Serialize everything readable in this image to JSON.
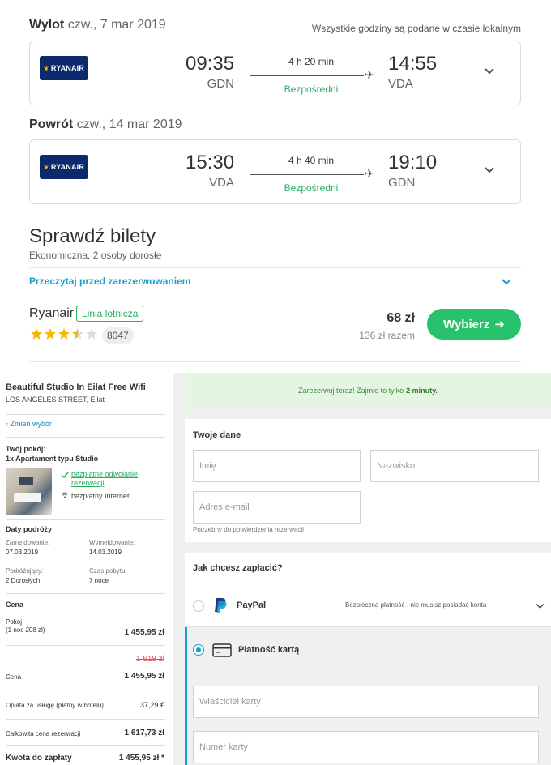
{
  "outbound": {
    "label": "Wylot",
    "date": "czw., 7 mar 2019",
    "airline_logo": "RYANAIR",
    "dep_time": "09:35",
    "dep_airport": "GDN",
    "duration": "4 h 20 min",
    "direct": "Bezpośredni",
    "arr_time": "14:55",
    "arr_airport": "VDA"
  },
  "timezone_note": "Wszystkie godziny są podane w czasie lokalnym",
  "inbound": {
    "label": "Powrót",
    "date": "czw., 14 mar 2019",
    "airline_logo": "RYANAIR",
    "dep_time": "15:30",
    "dep_airport": "VDA",
    "duration": "4 h 40 min",
    "direct": "Bezpośredni",
    "arr_time": "19:10",
    "arr_airport": "GDN"
  },
  "tickets": {
    "title": "Sprawdź bilety",
    "subtitle": "Ekonomiczna, 2 osoby dorosłe",
    "read_before": "Przeczytaj przed zarezerwowaniem",
    "provider": "Ryanair",
    "provider_badge": "Linia lotnicza",
    "rating_stars": 3.5,
    "review_count": "8047",
    "price": "68 zł",
    "price_total": "136 zł razem",
    "select_label": "Wybierz"
  },
  "hotel": {
    "name": "Beautiful Studio In Eilat Free Wifi",
    "address": "LOS ANGELES STREET, Eilat",
    "change_link": "Zmień wybór",
    "room_heading": "Twój pokój:",
    "room_type": "1x Apartament typu Studio",
    "feature_cancel": "bezpłatne odwołanie rezerwacji",
    "feature_internet": "bezpłatny Internet",
    "dates_heading": "Daty podróży",
    "checkin_label": "Zameldowanie:",
    "checkin_value": "07.03.2019",
    "checkout_label": "Wymeldowanie:",
    "checkout_value": "14.03.2019",
    "travelers_label": "Podróżujący:",
    "travelers_value": "2 Dorosłych",
    "stay_label": "Czas pobytu:",
    "stay_value": "7 noce",
    "price_heading": "Cena",
    "room_price_label": "Pokój",
    "room_price_sub": "(1 noc 208 zł)",
    "room_price_value": "1 455,95 zł",
    "old_price": "1 618 zł",
    "cena_label": "Cena",
    "cena_value": "1 455,95 zł",
    "service_fee_label": "Opłata za usługę (płatny w hotelu)",
    "service_fee_value": "37,29 €",
    "total_label": "Całkowita cena rezerwacji",
    "total_value": "1 617,73 zł",
    "pay_label": "Kwota do zapłaty",
    "pay_value": "1 455,95 zł *"
  },
  "booking": {
    "banner_text": "Zarezerwuj teraz! Zajmie to tylko",
    "banner_bold": "2 minuty.",
    "your_data_heading": "Twoje dane",
    "first_name_placeholder": "Imię",
    "last_name_placeholder": "Nazwisko",
    "email_placeholder": "Adres e-mail",
    "email_note": "Potrzebny do potwierdzenia rezerwacji",
    "payment_heading": "Jak chcesz zapłacić?",
    "paypal_label": "PayPal",
    "paypal_note": "Bezpieczna płatność - nie musisz posiadać konta",
    "card_label": "Płatność kartą",
    "card_owner_placeholder": "Właściciel karty",
    "card_number_placeholder": "Numer karty"
  },
  "colors": {
    "accent_green": "#27c26b",
    "link_blue": "#1ba0c7",
    "ryanair_blue": "#0c2a6b",
    "star": "#f5b700"
  }
}
